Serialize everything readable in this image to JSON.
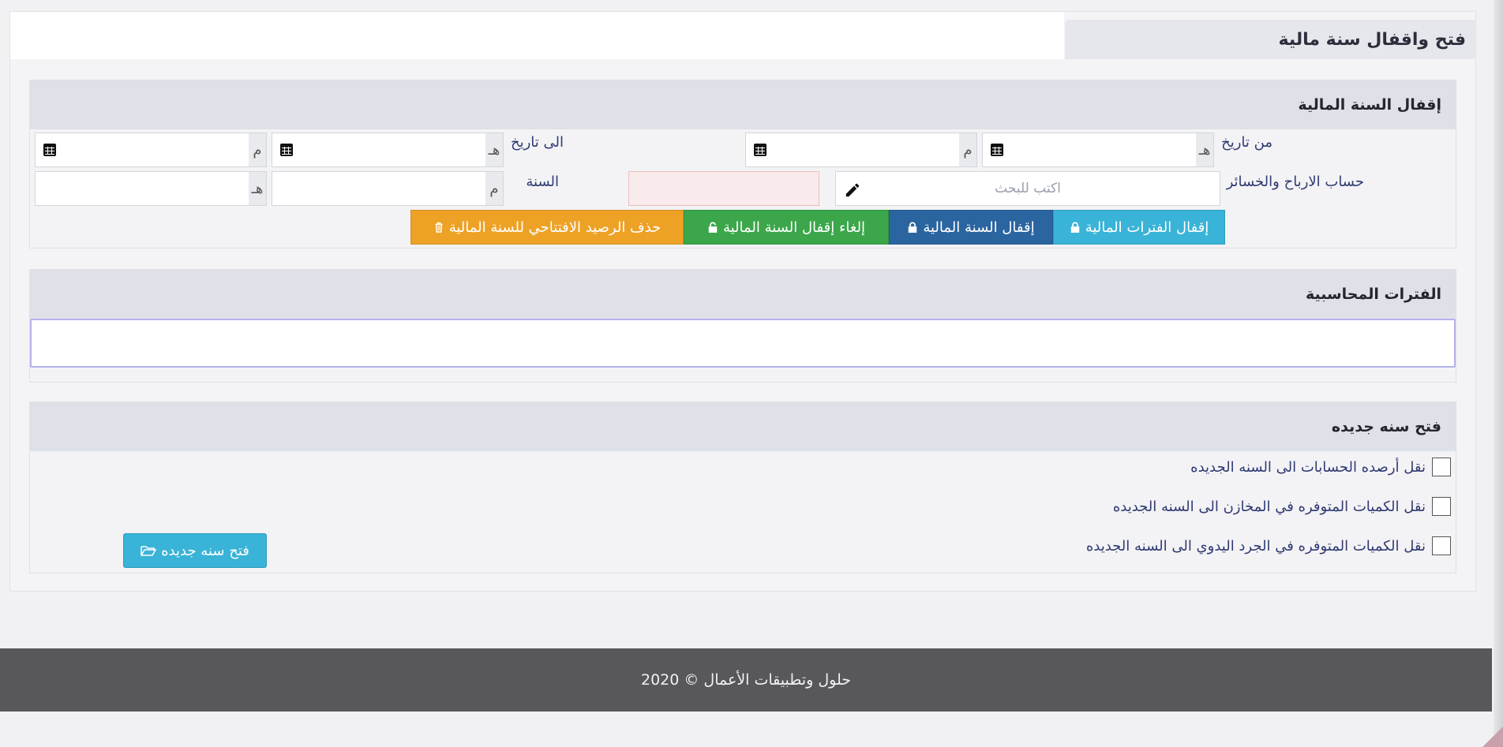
{
  "page": {
    "title": "فتح واقفال سنة مالية"
  },
  "close_section": {
    "title": "إقفال السنة المالية",
    "from_date_label": "من تاريخ",
    "to_date_label": "الى تاريخ",
    "hijri_suffix": "هـ",
    "greg_suffix": "م",
    "pl_account_label": "حساب الارباح والخسائر",
    "search_placeholder": "اكتب للبحث",
    "year_label": "السنة",
    "buttons": {
      "close_periods": "إقفال الفترات المالية",
      "close_year": "إقفال السنة المالية",
      "cancel_close": "إلغاء إقفال السنة المالية",
      "delete_opening": "حذف الرصيد الافتتاحي للسنة المالية"
    },
    "colors": {
      "close_periods": "#39b3d7",
      "close_year": "#2a65a0",
      "cancel_close": "#3ba64a",
      "delete_opening": "#eda226"
    }
  },
  "periods_section": {
    "title": "الفترات المحاسبية"
  },
  "new_year_section": {
    "title": "فتح سنه جديده",
    "options": [
      "نقل أرصده الحسابات الى السنه الجديده",
      "نقل الكميات المتوفره في المخازن الى السنه الجديده",
      "نقل الكميات المتوفره في الجرد اليدوي الى السنه الجديده"
    ],
    "open_button": "فتح سنه جديده"
  },
  "footer": {
    "text": "2020 © حلول وتطبيقات الأعمال"
  }
}
